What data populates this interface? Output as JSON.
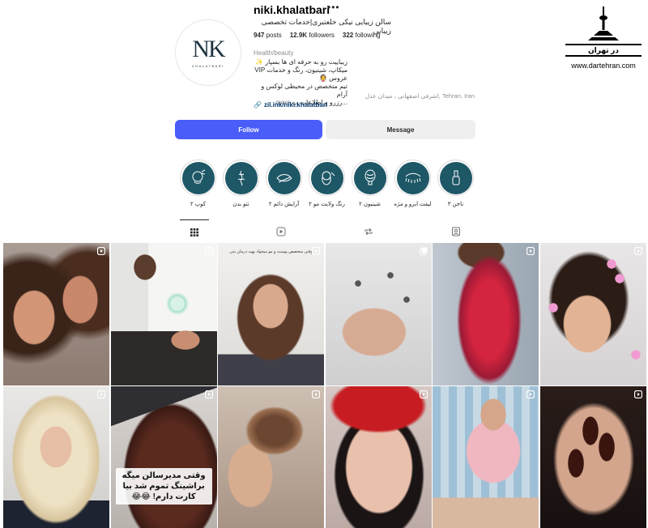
{
  "profile": {
    "username": "niki.khalatbari",
    "fullname": "سالن زیبایی نیکی خلعتبری|خدمات تخصصی زیبایی",
    "avatar_text": "NK",
    "avatar_subtext": "KHALATBARI",
    "stats": {
      "posts_value": "947",
      "posts_label": "posts",
      "followers_value": "12.9K",
      "followers_label": "followers",
      "following_value": "322",
      "following_label": "following"
    },
    "category": "Health/beauty",
    "bio_lines": [
      "زیباییت رو به حرفه ای ها بسپار ✨",
      "میکاپ، شینیون، رنگ و خدمات VIP عروس 👰",
      "تیم متخصص در محیطی لوکس و آرام",
      "...رزرو و اطلاعات ب"
    ],
    "bio_more": "more",
    "address": "اشرفی اصفهانی ، میدان عدل, Tehran, Iran",
    "link": "zil.ink/niki.khalatbari"
  },
  "actions": {
    "follow_label": "Follow",
    "message_label": "Message"
  },
  "highlights": [
    {
      "label": "کوپ ۲",
      "icon": "hair-cut-icon"
    },
    {
      "label": "تتو بدن",
      "icon": "tattoo-icon"
    },
    {
      "label": "آرایش دائم ۲",
      "icon": "eyeliner-icon"
    },
    {
      "label": "رنگ ولایت مو ۲",
      "icon": "hair-color-icon"
    },
    {
      "label": "شینیون ۲",
      "icon": "updo-icon"
    },
    {
      "label": "لیفت ابرو و مژه",
      "icon": "lash-lift-icon"
    },
    {
      "label": "ناخن ۳",
      "icon": "nail-polish-icon"
    }
  ],
  "tabs": [
    {
      "name": "posts",
      "icon": "grid-icon"
    },
    {
      "name": "reels",
      "icon": "reels-icon"
    },
    {
      "name": "reposts",
      "icon": "repost-icon"
    },
    {
      "name": "tagged",
      "icon": "tagged-icon"
    }
  ],
  "grid": [
    {
      "subject": "curly-hair-portrait",
      "type": "reel"
    },
    {
      "subject": "facial-treatment",
      "type": "reel"
    },
    {
      "subject": "salon-owner-portrait",
      "type": "reel",
      "top_text": "وقتی متخصص پوست و مو میخواد بهت درمان بدن"
    },
    {
      "subject": "white-nails",
      "type": "carousel"
    },
    {
      "subject": "red-wavy-hair",
      "type": "reel"
    },
    {
      "subject": "flower-portrait",
      "type": "reel"
    },
    {
      "subject": "blonde-waves",
      "type": "reel"
    },
    {
      "subject": "hair-straightening",
      "type": "reel",
      "overlay_text": "وقتی مدیرسالن میگه براشینگ تموم شد بیا کارت دارم! 😂😂"
    },
    {
      "subject": "bun-updo",
      "type": "reel"
    },
    {
      "subject": "red-beanie-makeup",
      "type": "reel"
    },
    {
      "subject": "salon-staff",
      "type": "reel"
    },
    {
      "subject": "dark-nails",
      "type": "reel"
    }
  ],
  "watermark": {
    "text": "در تهران",
    "url": "www.dartehran.com"
  },
  "colors": {
    "follow_bg": "#4a5df9",
    "highlight_bg": "#1e5766",
    "link": "#00376b"
  }
}
